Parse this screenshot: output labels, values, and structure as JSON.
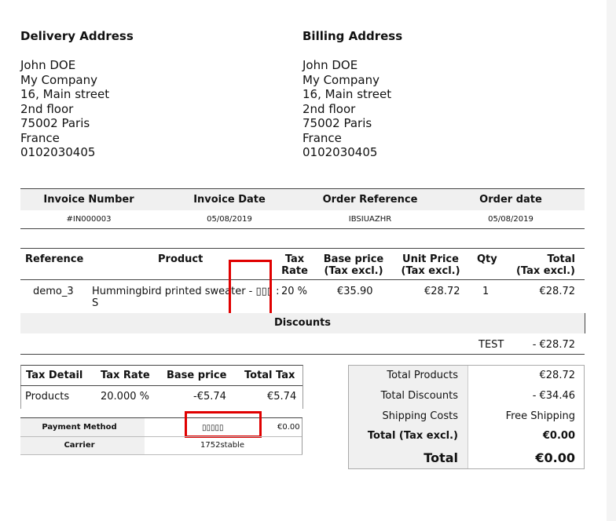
{
  "delivery": {
    "title": "Delivery Address",
    "lines": [
      "John DOE",
      "My Company",
      "16, Main street",
      "2nd floor",
      "75002 Paris",
      "France",
      "0102030405"
    ]
  },
  "billing": {
    "title": "Billing Address",
    "lines": [
      "John DOE",
      "My Company",
      "16, Main street",
      "2nd floor",
      "75002 Paris",
      "France",
      "0102030405"
    ]
  },
  "invoice_info": {
    "headers": [
      "Invoice Number",
      "Invoice Date",
      "Order Reference",
      "Order date"
    ],
    "values": [
      "#IN000003",
      "05/08/2019",
      "IBSIUAZHR",
      "05/08/2019"
    ]
  },
  "products": {
    "headers": {
      "reference": "Reference",
      "product": "Product",
      "tax_rate_1": "Tax",
      "tax_rate_2": "Rate",
      "base_price_1": "Base price",
      "base_price_2": "(Tax excl.)",
      "unit_price_1": "Unit Price",
      "unit_price_2": "(Tax excl.)",
      "qty": "Qty",
      "total_1": "Total",
      "total_2": "(Tax excl.)"
    },
    "row": {
      "reference": "demo_3",
      "product_line1": "Hummingbird printed sweater - ▯▯▯ :",
      "product_line2": "S",
      "tax_rate": "20 %",
      "base_price": "€35.90",
      "unit_price": "€28.72",
      "qty": "1",
      "total": "€28.72"
    }
  },
  "discounts": {
    "title": "Discounts",
    "name": "TEST",
    "value": "- €28.72"
  },
  "tax_detail": {
    "headers": [
      "Tax Detail",
      "Tax Rate",
      "Base price",
      "Total Tax"
    ],
    "row": [
      "Products",
      "20.000 %",
      "-€5.74",
      "€5.74"
    ]
  },
  "payment": {
    "method_label": "Payment Method",
    "method_value": "▯▯▯▯▯",
    "method_amount": "€0.00",
    "carrier_label": "Carrier",
    "carrier_value": "1752stable"
  },
  "totals": {
    "rows": [
      {
        "label": "Total Products",
        "value": "€28.72"
      },
      {
        "label": "Total Discounts",
        "value": "- €34.46"
      },
      {
        "label": "Shipping Costs",
        "value": "Free Shipping"
      },
      {
        "label": "Total (Tax excl.)",
        "value": "€0.00"
      }
    ],
    "grand_label": "Total",
    "grand_value": "€0.00"
  },
  "colors": {
    "highlight": "#e00000",
    "bar": "#f0f0f0"
  }
}
